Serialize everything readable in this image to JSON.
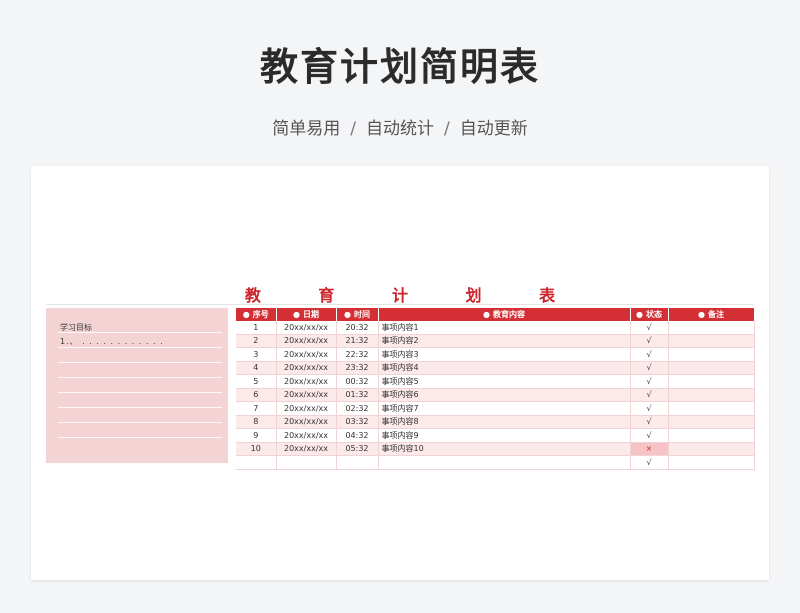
{
  "hero": {
    "title": "教育计划简明表",
    "subtitle_parts": [
      "简单易用",
      "自动统计",
      "自动更新"
    ],
    "separator": "/"
  },
  "sheet": {
    "title": "教 育 计 划 表",
    "goal_panel": {
      "title": "学习目标",
      "line1": "1.、 . . . . . . . . . . . ."
    },
    "table": {
      "bullet": "●",
      "headers": [
        "序号",
        "日期",
        "时间",
        "教育内容",
        "状态",
        "备注"
      ],
      "rows": [
        {
          "no": "1",
          "date": "20xx/xx/xx",
          "time": "20:32",
          "content": "事项内容1",
          "status": "√",
          "note": ""
        },
        {
          "no": "2",
          "date": "20xx/xx/xx",
          "time": "21:32",
          "content": "事项内容2",
          "status": "√",
          "note": ""
        },
        {
          "no": "3",
          "date": "20xx/xx/xx",
          "time": "22:32",
          "content": "事项内容3",
          "status": "√",
          "note": ""
        },
        {
          "no": "4",
          "date": "20xx/xx/xx",
          "time": "23:32",
          "content": "事项内容4",
          "status": "√",
          "note": ""
        },
        {
          "no": "5",
          "date": "20xx/xx/xx",
          "time": "00:32",
          "content": "事项内容5",
          "status": "√",
          "note": ""
        },
        {
          "no": "6",
          "date": "20xx/xx/xx",
          "time": "01:32",
          "content": "事项内容6",
          "status": "√",
          "note": ""
        },
        {
          "no": "7",
          "date": "20xx/xx/xx",
          "time": "02:32",
          "content": "事项内容7",
          "status": "√",
          "note": ""
        },
        {
          "no": "8",
          "date": "20xx/xx/xx",
          "time": "03:32",
          "content": "事项内容8",
          "status": "√",
          "note": ""
        },
        {
          "no": "9",
          "date": "20xx/xx/xx",
          "time": "04:32",
          "content": "事项内容9",
          "status": "√",
          "note": ""
        },
        {
          "no": "10",
          "date": "20xx/xx/xx",
          "time": "05:32",
          "content": "事项内容10",
          "status": "×",
          "note": ""
        },
        {
          "no": "",
          "date": "",
          "time": "",
          "content": "",
          "status": "√",
          "note": ""
        }
      ]
    },
    "colors": {
      "accent": "#d42f34",
      "title_red": "#cc2229",
      "panel_pink": "#f3d3d3",
      "row_pink": "#fce9ea"
    }
  }
}
